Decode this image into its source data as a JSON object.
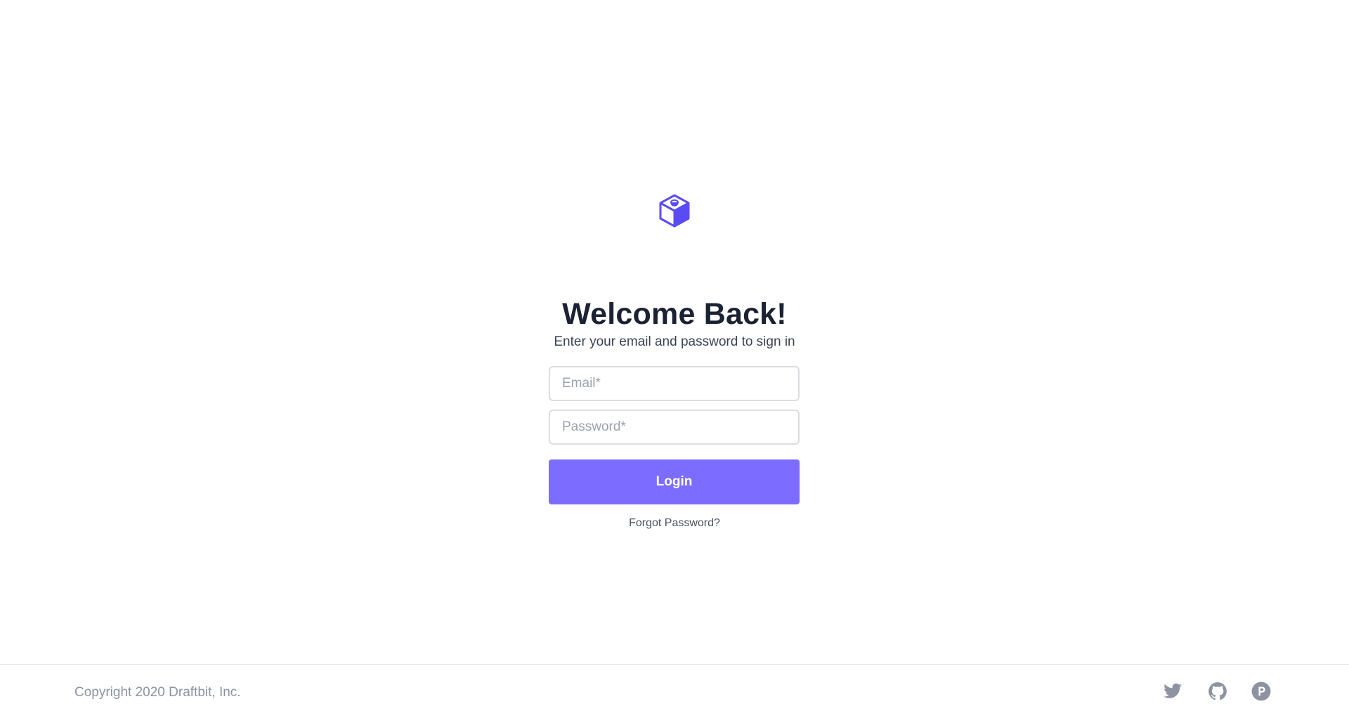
{
  "header": {
    "logo_icon": "cube-logo-icon"
  },
  "main": {
    "title": "Welcome Back!",
    "subtitle": "Enter your email and password to sign in",
    "email_placeholder": "Email*",
    "password_placeholder": "Password*",
    "login_label": "Login",
    "forgot_label": "Forgot Password?"
  },
  "footer": {
    "copyright": "Copyright 2020 Draftbit, Inc.",
    "social_icons": [
      "twitter-icon",
      "github-icon",
      "producthunt-icon"
    ]
  },
  "colors": {
    "accent": "#7c6cff",
    "logo": "#5b4bf5",
    "title": "#1a2233",
    "muted": "#8d93a1",
    "border": "#dcdde2"
  }
}
